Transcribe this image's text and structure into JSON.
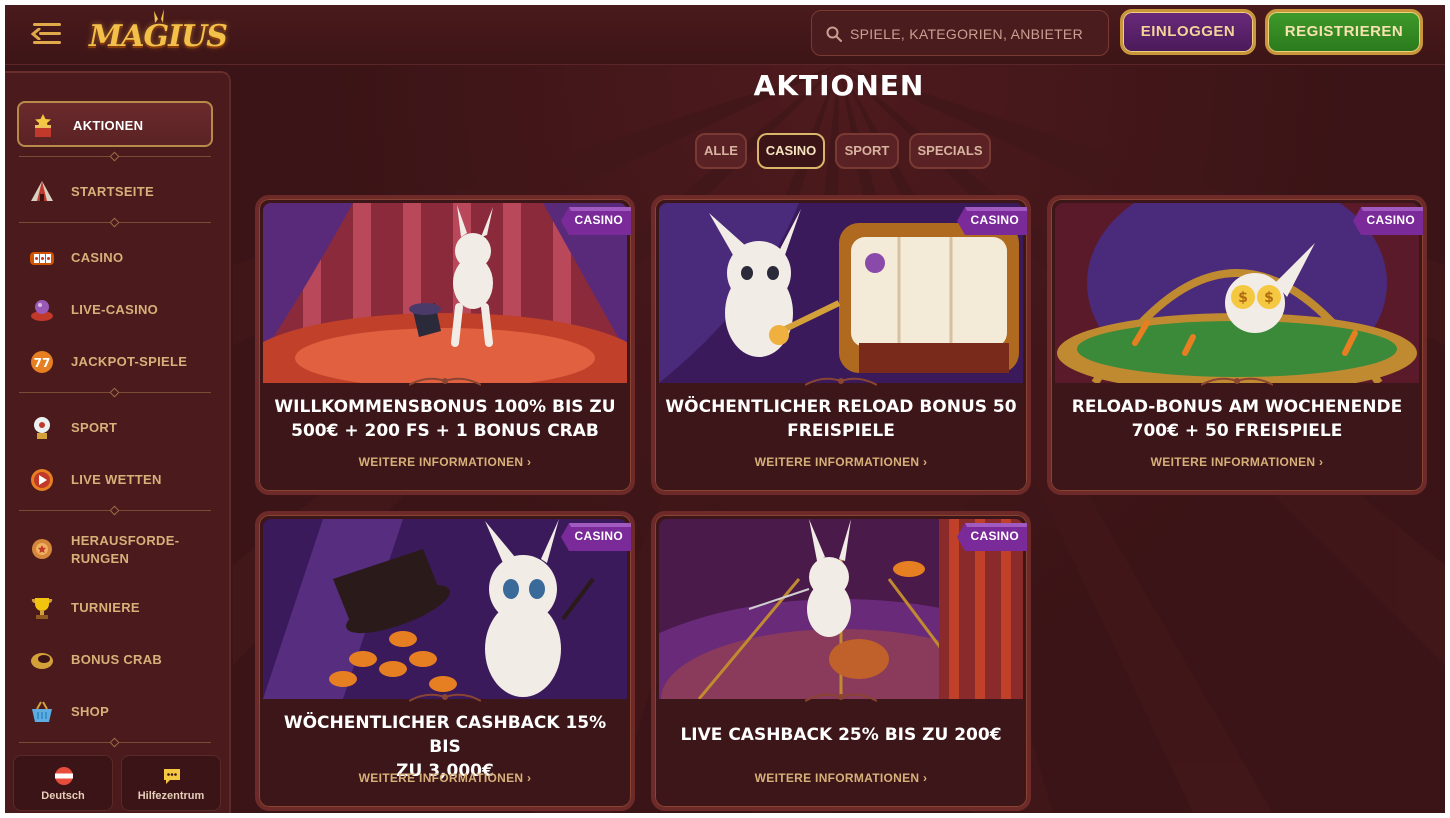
{
  "header": {
    "logo_text": "MAGIUS",
    "search_placeholder": "SPIELE, KATEGORIEN, ANBIETER",
    "login_label": "EINLOGGEN",
    "register_label": "REGISTRIEREN"
  },
  "sidebar": {
    "items": [
      {
        "label": "AKTIONEN"
      },
      {
        "label": "STARTSEITE"
      },
      {
        "label": "CASINO"
      },
      {
        "label": "LIVE-CASINO"
      },
      {
        "label": "JACKPOT-SPIELE"
      },
      {
        "label": "SPORT"
      },
      {
        "label": "LIVE WETTEN"
      },
      {
        "label": "HERAUSFORDE-"
      },
      {
        "label": "RUNGEN"
      },
      {
        "label": "TURNIERE"
      },
      {
        "label": "BONUS CRAB"
      },
      {
        "label": "SHOP"
      }
    ],
    "footer": {
      "language_label": "Deutsch",
      "help_label": "Hilfezentrum"
    }
  },
  "main": {
    "title": "AKTIONEN",
    "tabs": [
      {
        "label": "ALLE"
      },
      {
        "label": "CASINO"
      },
      {
        "label": "SPORT"
      },
      {
        "label": "SPECIALS"
      }
    ],
    "active_tab": "CASINO",
    "cards": [
      {
        "badge": "CASINO",
        "title_line1": "WILLKOMMENSBONUS 100% BIS ZU",
        "title_line2": "500€ + 200 FS + 1 BONUS CRAB",
        "more": "WEITERE INFORMATIONEN"
      },
      {
        "badge": "CASINO",
        "title_line1": "WÖCHENTLICHER RELOAD BONUS 50",
        "title_line2": "FREISPIELE",
        "more": "WEITERE INFORMATIONEN"
      },
      {
        "badge": "CASINO",
        "title_line1": "RELOAD-BONUS AM WOCHENENDE",
        "title_line2": "700€ + 50 FREISPIELE",
        "more": "WEITERE INFORMATIONEN"
      },
      {
        "badge": "CASINO",
        "title_line1": "WÖCHENTLICHER CASHBACK 15% BIS",
        "title_line2": "ZU 3,000€",
        "more": "WEITERE INFORMATIONEN"
      },
      {
        "badge": "CASINO",
        "title_line1": "LIVE CASHBACK 25% BIS ZU 200€",
        "title_line2": "",
        "more": "WEITERE INFORMATIONEN"
      }
    ]
  },
  "colors": {
    "background": "#3a1416",
    "accent_gold": "#d9b66a",
    "login_purple": "#5a2268",
    "register_green": "#3a8f26",
    "badge_purple": "#7b2a9a"
  }
}
